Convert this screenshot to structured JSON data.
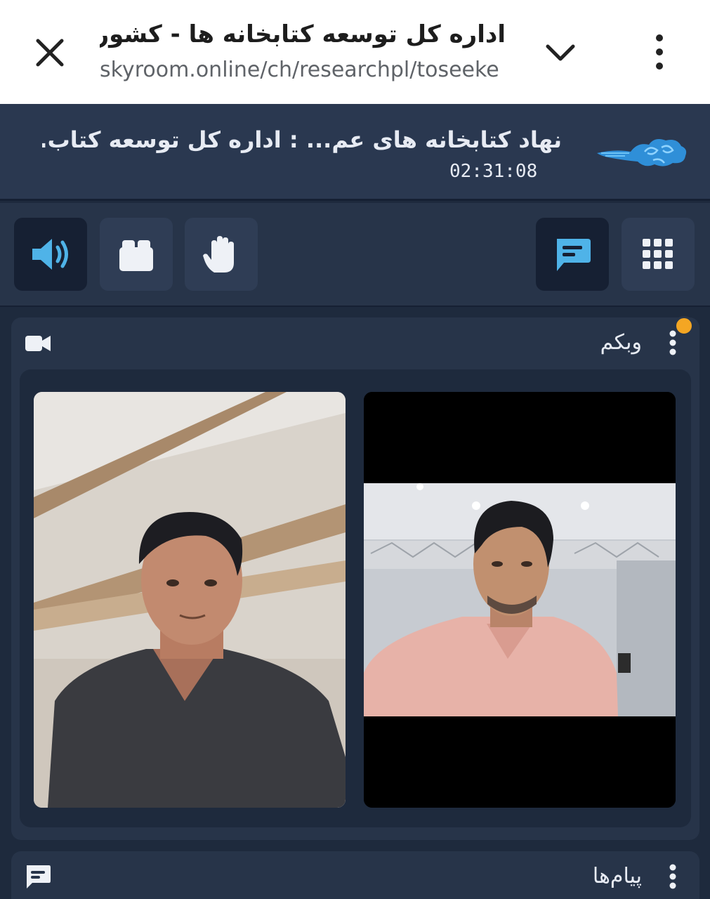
{
  "browser": {
    "title": "اداره کل توسعه کتابخانه ها - کشور",
    "url": "skyroom.online/ch/researchpl/toseeke",
    "icons": {
      "close": "close-icon",
      "chevron": "chevron-down-icon",
      "menu": "more-vert-icon"
    }
  },
  "room": {
    "title": "نهاد کتابخانه های عم... : اداره کل توسعه کتاب...",
    "timer": "02:31:08",
    "logo": "skyroom-cloud-logo"
  },
  "toolbar": {
    "buttons": [
      {
        "name": "speaker-button",
        "icon": "volume-icon",
        "active": true
      },
      {
        "name": "layout-button",
        "icon": "folder-icon",
        "active": false
      },
      {
        "name": "raise-hand-button",
        "icon": "hand-icon",
        "active": false
      },
      {
        "name": "chat-button",
        "icon": "chat-icon",
        "active": true
      },
      {
        "name": "apps-button",
        "icon": "grid-icon",
        "active": false
      }
    ]
  },
  "webcam": {
    "title": "وبکم",
    "icon": "video-camera-icon",
    "notification": true
  },
  "messages": {
    "title": "پیام‌ها",
    "icon": "chat-icon"
  },
  "colors": {
    "background": "#1e2a3d",
    "panel": "#273449",
    "accent": "#4fb3e8",
    "notification": "#f4a623"
  }
}
